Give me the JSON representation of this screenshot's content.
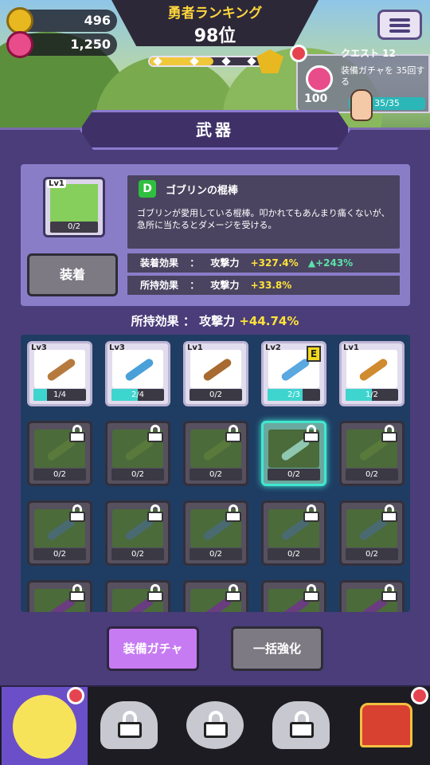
{
  "currencies": [
    {
      "name": "gold",
      "value": "496",
      "color": "#e8b820"
    },
    {
      "name": "gem",
      "value": "1,250",
      "color": "#e84c8a"
    }
  ],
  "ranking": {
    "title": "勇者ランキング",
    "value": "98位",
    "progress": 0.55
  },
  "quest": {
    "title": "クエスト 12",
    "description": "装備ガチャを 35回する",
    "reward": "100",
    "progress_text": "35/35",
    "progress": 1.0
  },
  "section_title": "武器",
  "selected_item": {
    "level": "Lv1",
    "count": "0/2",
    "rank": "D",
    "name": "ゴブリンの棍棒",
    "description": "ゴブリンが愛用している棍棒。叩かれてもあんまり痛くないが、急所に当たるとダメージを受ける。",
    "equip_label": "装着"
  },
  "effects": [
    {
      "label": "装着効果",
      "sep": "：",
      "stat": "攻撃力",
      "value": "+327.4%",
      "extra": "▲+243%"
    },
    {
      "label": "所持効果",
      "sep": "：",
      "stat": "攻撃力",
      "value": "+33.8%",
      "extra": ""
    }
  ],
  "total_effect": {
    "label": "所持効果 ： 攻撃力",
    "value": "+44.74%"
  },
  "items": [
    {
      "level": "Lv3",
      "count": "1/4",
      "progress": 0.25,
      "owned": true,
      "color": "#b77a3e",
      "badge": ""
    },
    {
      "level": "Lv3",
      "count": "2/4",
      "progress": 0.5,
      "owned": true,
      "color": "#4aa0d8",
      "badge": ""
    },
    {
      "level": "Lv1",
      "count": "0/2",
      "progress": 0,
      "owned": true,
      "color": "#a86a30",
      "badge": ""
    },
    {
      "level": "Lv2",
      "count": "2/3",
      "progress": 0.67,
      "owned": true,
      "color": "#5aa8e0",
      "badge": "E"
    },
    {
      "level": "Lv1",
      "count": "1/2",
      "progress": 0.5,
      "owned": true,
      "color": "#d08a30",
      "badge": ""
    },
    {
      "level": "",
      "count": "0/2",
      "owned": false,
      "color": "#5a7a3c"
    },
    {
      "level": "",
      "count": "0/2",
      "owned": false,
      "color": "#5a7a3c"
    },
    {
      "level": "",
      "count": "0/2",
      "owned": false,
      "color": "#5a7a3c"
    },
    {
      "level": "",
      "count": "0/2",
      "owned": false,
      "selected": true,
      "color": "#8fc7b0"
    },
    {
      "level": "",
      "count": "0/2",
      "owned": false,
      "color": "#5a7a3c"
    },
    {
      "level": "",
      "count": "0/2",
      "owned": false,
      "color": "#4a6a72"
    },
    {
      "level": "",
      "count": "0/2",
      "owned": false,
      "color": "#4a6a72"
    },
    {
      "level": "",
      "count": "0/2",
      "owned": false,
      "color": "#4a6a72"
    },
    {
      "level": "",
      "count": "0/2",
      "owned": false,
      "color": "#4a6a72"
    },
    {
      "level": "",
      "count": "0/2",
      "owned": false,
      "color": "#4a6a72"
    },
    {
      "level": "",
      "count": "",
      "owned": false,
      "color": "#6a3c80"
    },
    {
      "level": "",
      "count": "",
      "owned": false,
      "color": "#6a3c80"
    },
    {
      "level": "",
      "count": "",
      "owned": false,
      "color": "#6a3c80"
    },
    {
      "level": "",
      "count": "",
      "owned": false,
      "color": "#6a3c80"
    },
    {
      "level": "",
      "count": "",
      "owned": false,
      "color": "#6a3c80"
    }
  ],
  "buttons": {
    "gacha": "装備ガチャ",
    "enhance": "一括強化"
  },
  "nav": [
    {
      "name": "hero",
      "active": true,
      "alert": true
    },
    {
      "name": "locked-1",
      "locked": true
    },
    {
      "name": "locked-2",
      "locked": true
    },
    {
      "name": "locked-3",
      "locked": true
    },
    {
      "name": "chest",
      "alert": true
    }
  ],
  "colors": {
    "panel": "#4a3d7a",
    "accent": "#40e8d0",
    "gacha": "#c77bf2",
    "highlight": "#ffe23a"
  }
}
